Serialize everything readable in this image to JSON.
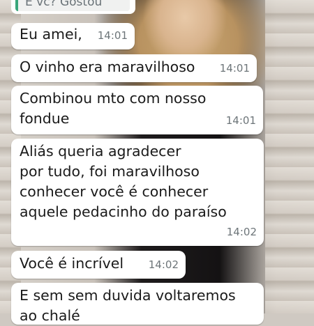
{
  "quoted_message": {
    "text": "É vc?  Gostou"
  },
  "messages": [
    {
      "text": "Eu amei,",
      "time": "14:01"
    },
    {
      "text": "O vinho era maravilhoso",
      "time": "14:01"
    },
    {
      "text": "Combinou mto com nosso\nfondue",
      "time": "14:01"
    },
    {
      "text": "Aliás queria agradecer\npor tudo, foi maravilhoso\nconhecer você é conhecer\naquele pedacinho do paraíso",
      "time": "14:02"
    },
    {
      "text": "Você é incrível",
      "time": "14:02"
    },
    {
      "text": "E sem sem duvida voltaremos\nao chalé",
      "time": ""
    }
  ]
}
